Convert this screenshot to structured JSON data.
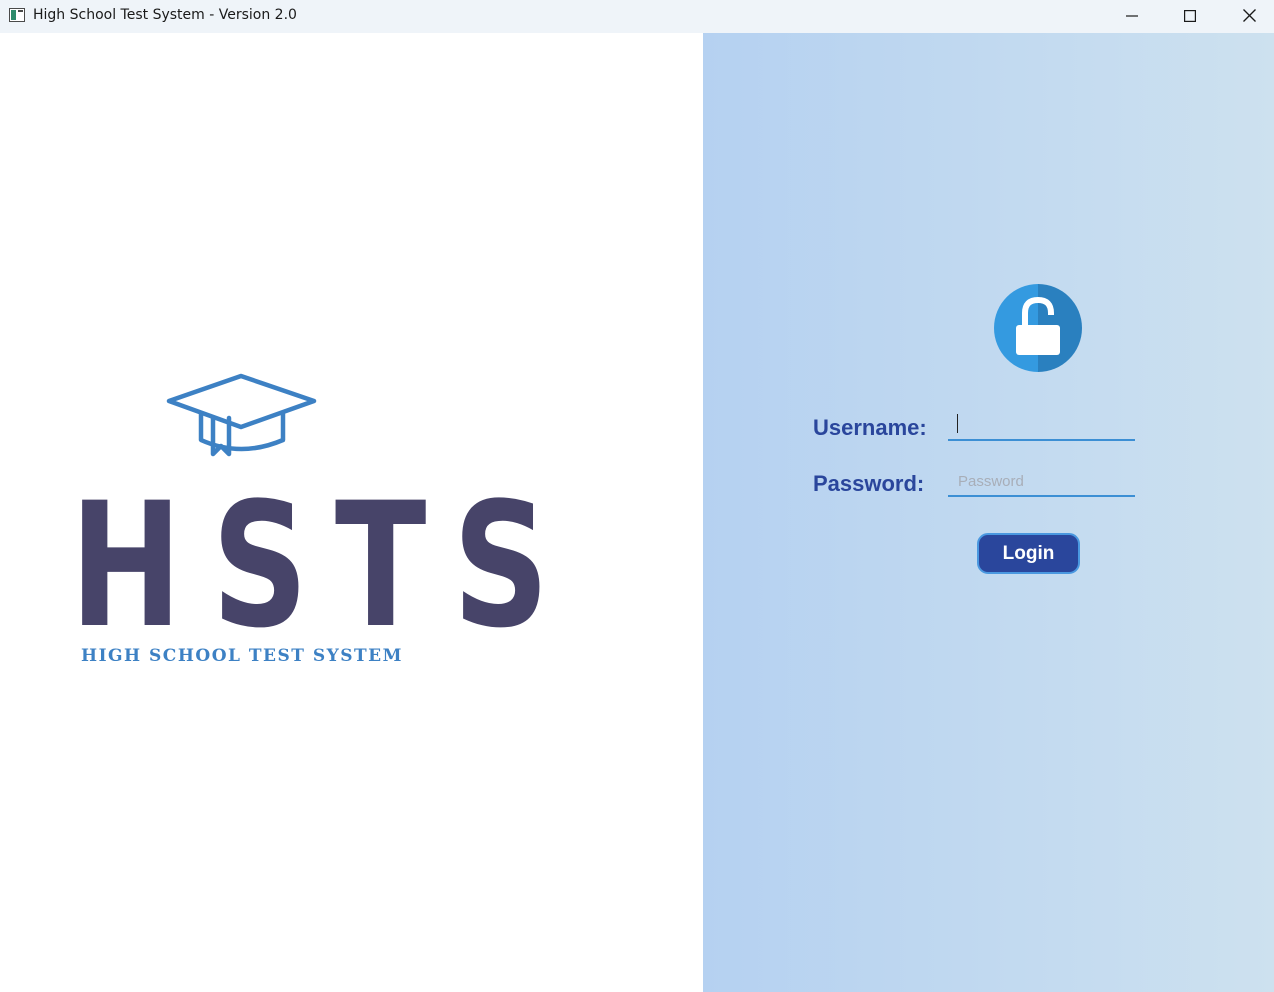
{
  "window": {
    "title": "High School Test System - Version 2.0",
    "controls": [
      "minimize-icon",
      "maximize-icon",
      "close-icon"
    ]
  },
  "logo": {
    "letters": [
      "H",
      "S",
      "T",
      "S"
    ],
    "tagline": "HIGH SCHOOL TEST SYSTEM",
    "icon": "graduation-cap-icon",
    "letter_color": "#474469",
    "accent_color": "#3d81c4"
  },
  "login": {
    "icon": "unlocked-padlock-icon",
    "username_label": "Username:",
    "username_value": "",
    "username_placeholder": "",
    "password_label": "Password:",
    "password_value": "",
    "password_placeholder": "Password",
    "button_label": "Login",
    "label_color": "#2a469c",
    "button_color": "#2a469c",
    "badge_color": "#2f93d8"
  }
}
